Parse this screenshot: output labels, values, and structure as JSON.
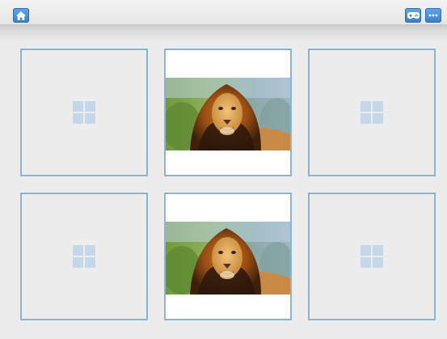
{
  "toolbar": {
    "left_buttons": [
      {
        "icon": "home-icon"
      }
    ],
    "right_buttons": [
      {
        "icon": "gamepad-icon"
      },
      {
        "icon": "more-icon"
      }
    ]
  },
  "board": {
    "rows": 2,
    "columns": 3,
    "cards": [
      {
        "position": 1,
        "state": "face-down",
        "icon": "card-back-windows-icon"
      },
      {
        "position": 2,
        "state": "face-up",
        "image": "lion"
      },
      {
        "position": 3,
        "state": "face-down",
        "icon": "card-back-windows-icon"
      },
      {
        "position": 4,
        "state": "face-down",
        "icon": "card-back-windows-icon"
      },
      {
        "position": 5,
        "state": "face-up",
        "image": "lion"
      },
      {
        "position": 6,
        "state": "face-down",
        "icon": "card-back-windows-icon"
      }
    ]
  },
  "colors": {
    "accent": "#3a7fc7",
    "card_border": "#8ab4d4",
    "card_back_icon": "#c5d8ea",
    "background": "#ececec"
  }
}
